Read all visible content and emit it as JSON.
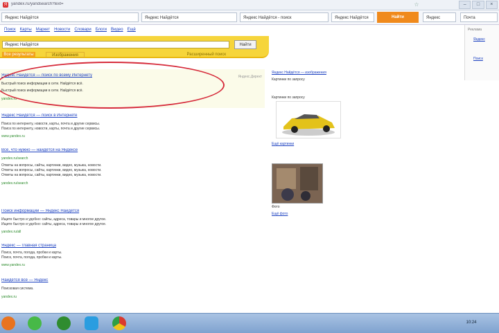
{
  "browser": {
    "url": "yandex.ru/yandsearch?text=",
    "star_glyph": "☆",
    "window_controls": [
      "–",
      "□",
      "×"
    ]
  },
  "toolbar": {
    "tabs": [
      {
        "label": "Яндекс Найдётся"
      },
      {
        "label": "Яндекс Найдётся"
      },
      {
        "label": "Яндекс Найдётся - поиск"
      },
      {
        "label": "Яндекс Найдётся"
      }
    ],
    "orange_button": "Найти",
    "right_tabs": [
      "Яндекс",
      "Почта"
    ]
  },
  "nav": [
    "Поиск",
    "Карты",
    "Маркет",
    "Новости",
    "Словари",
    "Блоги",
    "Видео",
    "Ещё"
  ],
  "search": {
    "query": "Яндекс Найдётся",
    "button": "Найти",
    "tabs": [
      "Все результаты",
      "Изображения"
    ],
    "right_label": "Расширенный поиск"
  },
  "ad": {
    "label": "Яндекс.Директ",
    "title": "Яндекс Найдётся — поиск по всему Интернету",
    "snippet": "Быстрый поиск информации в сети. Найдётся всё.",
    "url": "yandex.ru"
  },
  "results": [
    {
      "title": "Яндекс Найдётся — поиск в Интернете",
      "snippet": "Поиск по интернету, новости, карты, почта и другие сервисы.",
      "url": "www.yandex.ru"
    },
    {
      "title": "Всё, что нужно — найдётся на Яндексе",
      "snippet": "Ответы на вопросы, сайты, картинки, видео, музыка, новости.",
      "url": "yandex.ru/search"
    },
    {
      "title": "Поиск информации — Яндекс Найдётся",
      "snippet": "Ищите быстро и удобно: сайты, адреса, товары и многое другое.",
      "url": "yandex.ru/all"
    },
    {
      "title": "Яндекс — главная страница",
      "snippet": "Поиск, почта, погода, пробки и карты.",
      "url": "www.yandex.ru"
    },
    {
      "title": "Найдётся всё — Яндекс",
      "snippet": "Поисковая система.",
      "url": "yandex.ru"
    }
  ],
  "sidebar": {
    "top_link": "Яндекс Найдётся — изображения",
    "caption_1": "Картинки по запросу",
    "car_link": "Ещё картинки",
    "photo_caption": "Фото",
    "photo_link": "Ещё фото"
  },
  "panel": {
    "title": "Реклама",
    "links": [
      "Яндекс",
      "Поиск"
    ]
  },
  "taskbar": {
    "time": "10:24",
    "icons": [
      "firefox-icon",
      "utorrent-icon",
      "winamp-icon",
      "skype-icon",
      "chrome-icon"
    ]
  },
  "colors": {
    "yandex_yellow": "#f6d53b",
    "link_blue": "#1a3fc0",
    "url_green": "#2a8a2a",
    "highlight_red": "#d62b3b",
    "orange_button": "#f08a1c"
  }
}
